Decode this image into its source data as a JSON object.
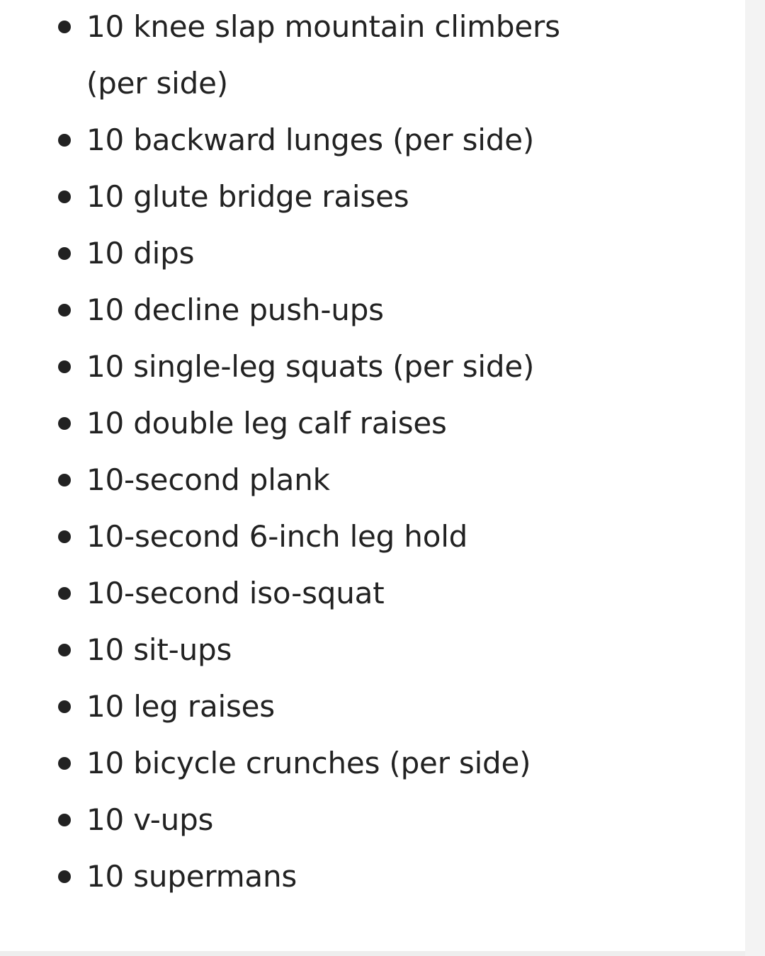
{
  "list": {
    "items": [
      "10 knee slap mountain climbers (per side)",
      "10 backward lunges (per side)",
      "10 glute bridge raises",
      "10 dips",
      "10 decline push-ups",
      "10 single-leg squats (per side)",
      "10 double leg calf raises",
      "10-second plank",
      "10-second 6-inch leg hold",
      "10-second iso-squat",
      "10 sit-ups",
      "10 leg raises",
      "10 bicycle crunches (per side)",
      "10 v-ups",
      "10 supermans"
    ]
  }
}
